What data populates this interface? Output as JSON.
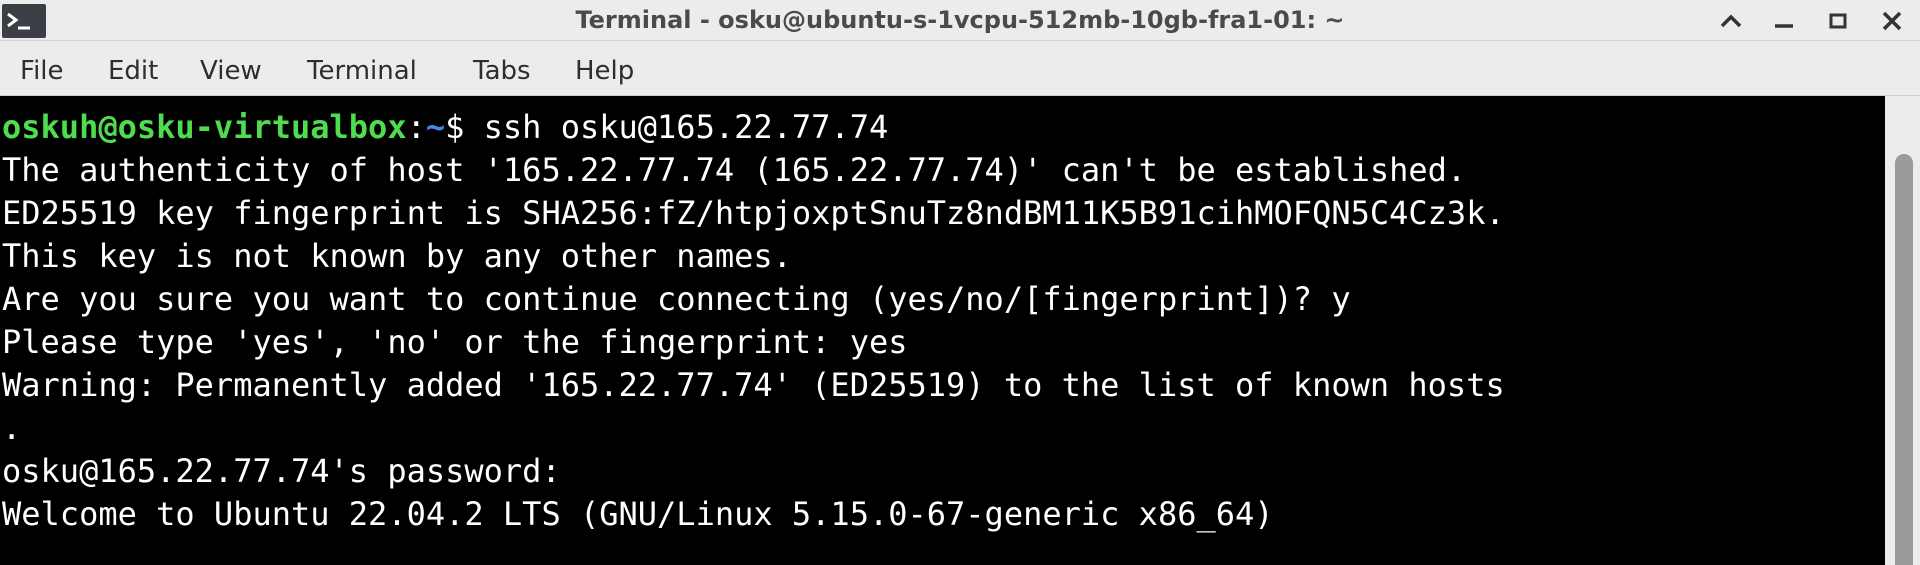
{
  "window": {
    "title": "Terminal - osku@ubuntu-s-1vcpu-512mb-10gb-fra1-01: ~",
    "app_icon": "terminal-icon",
    "controls": [
      "chevron-up-icon",
      "minimize-icon",
      "maximize-icon",
      "close-icon"
    ]
  },
  "menu": {
    "file": "File",
    "edit": "Edit",
    "view": "View",
    "terminal": "Terminal",
    "tabs": "Tabs",
    "help": "Help"
  },
  "terminal": {
    "prompt_user": "oskuh@osku-virtualbox",
    "prompt_sep": ":",
    "prompt_path": "~",
    "prompt_symbol": "$ ",
    "command": "ssh osku@165.22.77.74",
    "lines": [
      "The authenticity of host '165.22.77.74 (165.22.77.74)' can't be established.",
      "ED25519 key fingerprint is SHA256:fZ/htpjoxptSnuTz8ndBM11K5B91cihMOFQN5C4Cz3k.",
      "This key is not known by any other names.",
      "Are you sure you want to continue connecting (yes/no/[fingerprint])? y",
      "Please type 'yes', 'no' or the fingerprint: yes",
      "Warning: Permanently added '165.22.77.74' (ED25519) to the list of known hosts",
      ".",
      "osku@165.22.77.74's password:",
      "Welcome to Ubuntu 22.04.2 LTS (GNU/Linux 5.15.0-67-generic x86_64)"
    ]
  },
  "colors": {
    "prompt_user": "#4fdc4f",
    "prompt_path": "#4a86e8",
    "background": "#000000",
    "text": "#ffffff"
  }
}
